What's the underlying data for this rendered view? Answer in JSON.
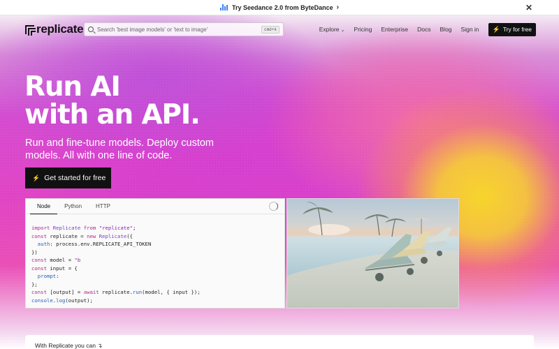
{
  "announcement": {
    "text": "Try Seedance 2.0 from ByteDance",
    "chevron": "›",
    "close_icon": "✕"
  },
  "nav": {
    "logo": "replicate",
    "search_placeholder": "Search 'best image models' or 'text to image'",
    "search_shortcut": "cmd+k",
    "links": [
      "Explore",
      "Pricing",
      "Enterprise",
      "Docs",
      "Blog",
      "Sign in"
    ],
    "explore_caret": "⌄",
    "cta": "Try for free",
    "bolt_icon": "⚡"
  },
  "hero": {
    "title_line1": "Run AI",
    "title_line2": "with an API.",
    "subtitle": "Run and fine-tune models. Deploy custom models. All with one line of code.",
    "cta": "Get started for free"
  },
  "code_card": {
    "tabs": [
      "Node",
      "Python",
      "HTTP"
    ],
    "active_tab": "Node",
    "lines": [
      "import Replicate from \"replicate\";",
      "const replicate = new Replicate({",
      "  auth: process.env.REPLICATE_API_TOKEN",
      "})",
      "const model = \"b",
      "const input = {",
      "  prompt:",
      "};",
      "const [output] = await replicate.run(model, { input });",
      "console.log(output);"
    ]
  },
  "bottom": {
    "text": "With Replicate you can",
    "arrow": "↴"
  },
  "colors": {
    "accent_dark": "#111111",
    "gradient_magenta": "#d54bd0",
    "gradient_yellow": "#f7d52a",
    "keyword": "#b0268f"
  }
}
